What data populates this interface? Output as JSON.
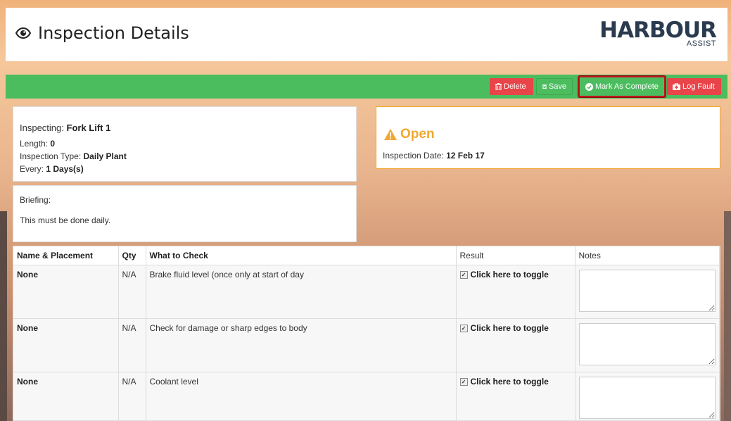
{
  "header": {
    "title": "Inspection Details",
    "logo_text": "HARBOUR",
    "logo_sub": "ASSIST"
  },
  "toolbar": {
    "delete_label": "Delete",
    "save_label": "Save",
    "complete_label": "Mark As Complete",
    "logfault_label": "Log Fault"
  },
  "inspecting": {
    "label": "Inspecting:",
    "value": "Fork Lift 1",
    "length_label": "Length:",
    "length_value": "0",
    "type_label": "Inspection Type:",
    "type_value": "Daily Plant",
    "every_label": "Every:",
    "every_value": "1 Days(s)"
  },
  "briefing": {
    "label": "Briefing:",
    "text": "This must be done daily."
  },
  "status": {
    "title": "Open",
    "date_label": "Inspection Date:",
    "date_value": "12 Feb 17",
    "color": "#f0a830"
  },
  "table": {
    "headers": [
      "Name & Placement",
      "Qty",
      "What to Check",
      "Result",
      "Notes"
    ],
    "rows": [
      {
        "name": "None",
        "qty": "N/A",
        "check": "Brake fluid level (once only at start of day",
        "result": "Click here to toggle",
        "notes": ""
      },
      {
        "name": "None",
        "qty": "N/A",
        "check": "Check for damage or sharp edges to body",
        "result": "Click here to toggle",
        "notes": ""
      },
      {
        "name": "None",
        "qty": "N/A",
        "check": "Coolant level",
        "result": "Click here to toggle",
        "notes": ""
      }
    ]
  },
  "colors": {
    "toolbar_green": "#4cbd5f",
    "danger_red": "#e84449",
    "highlight_border": "#c0151c"
  }
}
